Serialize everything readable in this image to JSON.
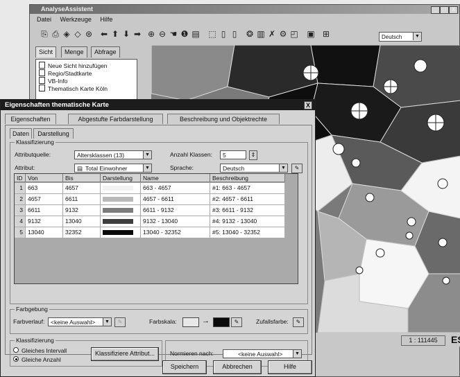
{
  "app": {
    "title": "AnalyseAssistent",
    "menu": [
      "Datei",
      "Werkzeuge",
      "Hilfe"
    ],
    "language": "Deutsch",
    "window_buttons": [
      "_",
      "□",
      "X"
    ],
    "tabs": [
      "Sicht",
      "Menge",
      "Abfrage"
    ],
    "layers": [
      "Neue Sicht hinzufügen",
      "Regio/Stadtkarte",
      "VB-Info",
      "Thematisch Karte Köln"
    ],
    "scale": "1 : 111445",
    "brand": "ESRI"
  },
  "dialog": {
    "title": "Eigenschaften thematische Karte",
    "close": "X",
    "tabs": [
      "Eigenschaften",
      "Abgestufte Farbdarstellung",
      "Beschreibung und Objektrechte"
    ],
    "subtabs": [
      "Daten",
      "Darstellung"
    ],
    "klassifizierung": {
      "legend": "Klassifizierung",
      "attributquelle_label": "Attributquelle:",
      "attributquelle_value": "Altersklassen (13)",
      "anzahl_label": "Anzahl Klassen:",
      "anzahl_value": "5",
      "attribut_label": "Attribut:",
      "attribut_value": "Total Einwohner",
      "sprache_label": "Sprache:",
      "sprache_value": "Deutsch"
    },
    "table": {
      "columns": [
        "ID",
        "Von",
        "Bis",
        "Darstellung",
        "Name",
        "Beschreibung"
      ],
      "rows": [
        {
          "id": "1",
          "von": "663",
          "bis": "4657",
          "color": "#f2f2f2",
          "name": "663 - 4657",
          "desc": "#1: 663 - 4657"
        },
        {
          "id": "2",
          "von": "4657",
          "bis": "6611",
          "color": "#b9b9b9",
          "name": "4657 - 6611",
          "desc": "#2: 4657 - 6611"
        },
        {
          "id": "3",
          "von": "6611",
          "bis": "9132",
          "color": "#7c7c7c",
          "name": "6611 - 9132",
          "desc": "#3: 6611 - 9132"
        },
        {
          "id": "4",
          "von": "9132",
          "bis": "13040",
          "color": "#3e3e3e",
          "name": "9132 - 13040",
          "desc": "#4: 9132 - 13040"
        },
        {
          "id": "5",
          "von": "13040",
          "bis": "32352",
          "color": "#0a0a0a",
          "name": "13040 - 32352",
          "desc": "#5: 13040 - 32352"
        }
      ]
    },
    "farbgebung": {
      "legend": "Farbgebung",
      "farbverlauf_label": "Farbverlauf:",
      "farbverlauf_value": "<keine Auswahl>",
      "farbskala_label": "Farbskala:",
      "farbskala_start": "#e8e8e8",
      "farbskala_end": "#0a0a0a",
      "arrow": "→",
      "zufall_label": "Zufallsfarbe:"
    },
    "klassifizierung2": {
      "legend": "Klassifizierung",
      "option1": "Gleiches Intervall",
      "option2": "Gleiche Anzahl",
      "selected": "Gleiche Anzahl",
      "button": "Klassifiziere Attribut...",
      "normieren_label": "Normieren nach:",
      "normieren_value": "<keine Auswahl>"
    },
    "buttons": {
      "save": "Speichern",
      "cancel": "Abbrechen",
      "help": "Hilfe"
    }
  }
}
